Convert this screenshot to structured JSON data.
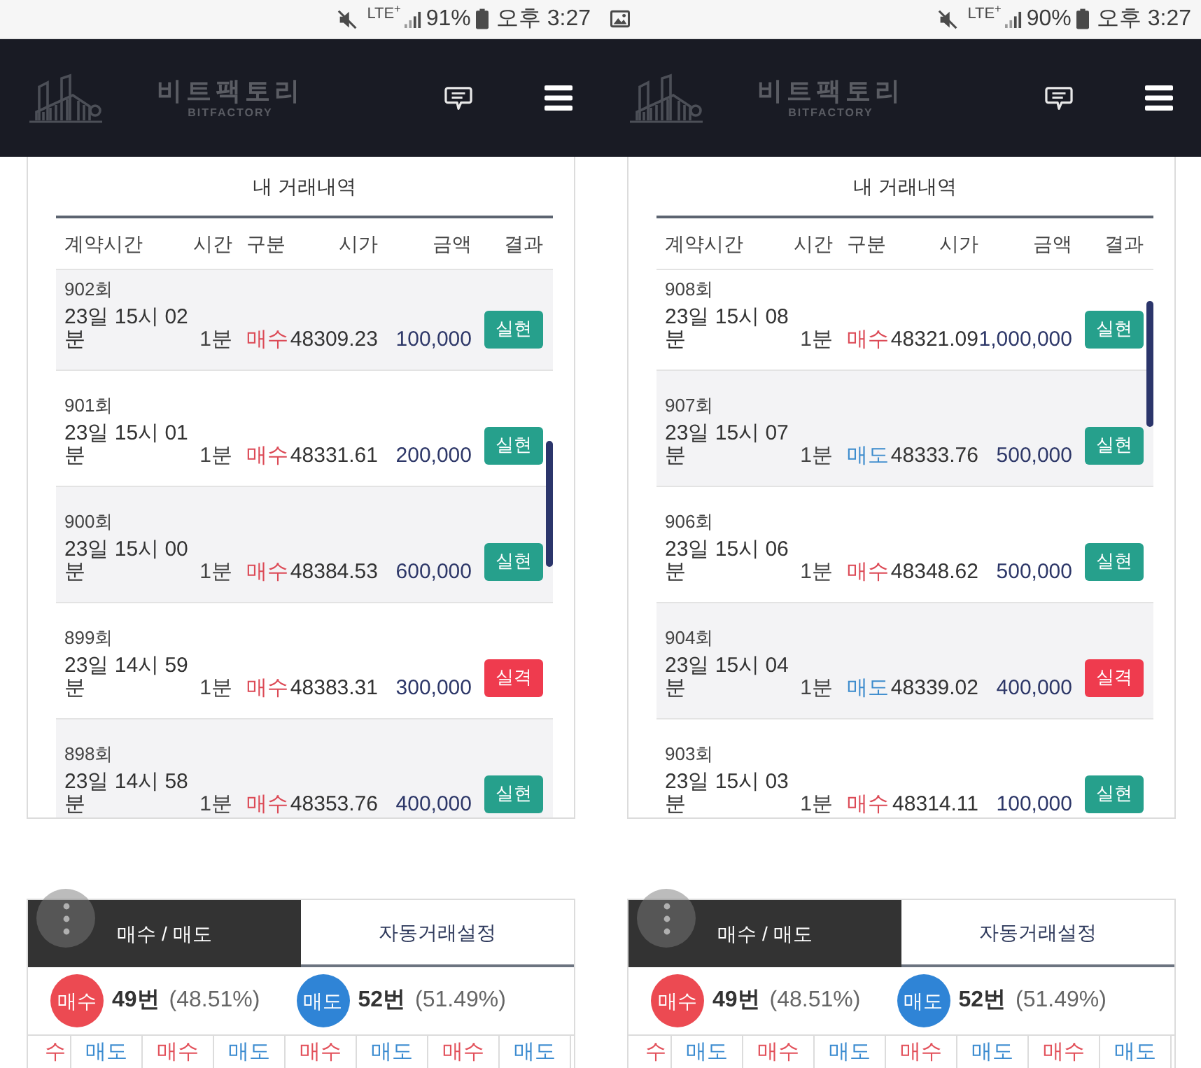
{
  "screens": [
    {
      "status_bar": {
        "image_notification": false,
        "network": "LTE$^{+}$",
        "battery": "91%",
        "clock": "오후 3:27"
      },
      "header": {
        "brand": "비트팩토리",
        "brand_sub": "BITFACTORY"
      },
      "history": {
        "title": "내 거래내역",
        "columns": [
          "계약시간",
          "시간",
          "구분",
          "시가",
          "금액",
          "결과"
        ],
        "rows": [
          {
            "round": "902회",
            "date": "23일 15시 02분",
            "duration": "1분",
            "side": {
              "text": "매수",
              "color": "#dc4a56"
            },
            "price": "48309.23",
            "amount": "100,000",
            "result": {
              "text": "실현",
              "color": "#26a08c"
            },
            "shaded": true
          },
          {
            "round": "901회",
            "date": "23일 15시 01분",
            "duration": "1분",
            "side": {
              "text": "매수",
              "color": "#dc4a56"
            },
            "price": "48331.61",
            "amount": "200,000",
            "result": {
              "text": "실현",
              "color": "#26a08c"
            },
            "shaded": false
          },
          {
            "round": "900회",
            "date": "23일 15시 00분",
            "duration": "1분",
            "side": {
              "text": "매수",
              "color": "#dc4a56"
            },
            "price": "48384.53",
            "amount": "600,000",
            "result": {
              "text": "실현",
              "color": "#26a08c"
            },
            "shaded": true
          },
          {
            "round": "899회",
            "date": "23일 14시 59분",
            "duration": "1분",
            "side": {
              "text": "매수",
              "color": "#dc4a56"
            },
            "price": "48383.31",
            "amount": "300,000",
            "result": {
              "text": "실격",
              "color": "#ef3b4e"
            },
            "shaded": false
          },
          {
            "round": "898회",
            "date": "23일 14시 58분",
            "duration": "1분",
            "side": {
              "text": "매수",
              "color": "#dc4a56"
            },
            "price": "48353.76",
            "amount": "400,000",
            "result": {
              "text": "실현",
              "color": "#26a08c"
            },
            "shaded": true
          }
        ]
      },
      "tabs": [
        {
          "label": "매수 / 매도",
          "selected": true
        },
        {
          "label": "자동거래설정",
          "selected": false
        }
      ],
      "stats": [
        {
          "badge": "매수",
          "color": "#ec4a52",
          "count": "49번",
          "percent": "(48.51%)"
        },
        {
          "badge": "매도",
          "color": "#2f84d6",
          "count": "52번",
          "percent": "(51.49%)"
        }
      ],
      "strip": [
        {
          "text": "수",
          "color": "#e2505a"
        },
        {
          "text": "매도",
          "color": "#3b8bd0"
        },
        {
          "text": "매수",
          "color": "#e2505a"
        },
        {
          "text": "매도",
          "color": "#3b8bd0"
        },
        {
          "text": "매수",
          "color": "#e2505a"
        },
        {
          "text": "매도",
          "color": "#3b8bd0"
        },
        {
          "text": "매수",
          "color": "#e2505a"
        },
        {
          "text": "매도",
          "color": "#3b8bd0"
        }
      ]
    },
    {
      "status_bar": {
        "image_notification": true,
        "network": "LTE$^{+}$",
        "battery": "90%",
        "clock": "오후 3:27"
      },
      "header": {
        "brand": "비트팩토리",
        "brand_sub": "BITFACTORY"
      },
      "history": {
        "title": "내 거래내역",
        "columns": [
          "계약시간",
          "시간",
          "구분",
          "시가",
          "금액",
          "결과"
        ],
        "rows": [
          {
            "round": "908회",
            "date": "23일 15시 08분",
            "duration": "1분",
            "side": {
              "text": "매수",
              "color": "#dc4a56"
            },
            "price": "48321.09",
            "amount": "1,000,000",
            "result": {
              "text": "실현",
              "color": "#26a08c"
            },
            "shaded": false
          },
          {
            "round": "907회",
            "date": "23일 15시 07분",
            "duration": "1분",
            "side": {
              "text": "매도",
              "color": "#3d8ccd"
            },
            "price": "48333.76",
            "amount": "500,000",
            "result": {
              "text": "실현",
              "color": "#26a08c"
            },
            "shaded": true
          },
          {
            "round": "906회",
            "date": "23일 15시 06분",
            "duration": "1분",
            "side": {
              "text": "매수",
              "color": "#dc4a56"
            },
            "price": "48348.62",
            "amount": "500,000",
            "result": {
              "text": "실현",
              "color": "#26a08c"
            },
            "shaded": false
          },
          {
            "round": "904회",
            "date": "23일 15시 04분",
            "duration": "1분",
            "side": {
              "text": "매도",
              "color": "#3d8ccd"
            },
            "price": "48339.02",
            "amount": "400,000",
            "result": {
              "text": "실격",
              "color": "#ef3b4e"
            },
            "shaded": true
          },
          {
            "round": "903회",
            "date": "23일 15시 03분",
            "duration": "1분",
            "side": {
              "text": "매수",
              "color": "#dc4a56"
            },
            "price": "48314.11",
            "amount": "100,000",
            "result": {
              "text": "실현",
              "color": "#26a08c"
            },
            "shaded": false
          }
        ]
      },
      "tabs": [
        {
          "label": "매수 / 매도",
          "selected": true
        },
        {
          "label": "자동거래설정",
          "selected": false
        }
      ],
      "stats": [
        {
          "badge": "매수",
          "color": "#ec4a52",
          "count": "49번",
          "percent": "(48.51%)"
        },
        {
          "badge": "매도",
          "color": "#2f84d6",
          "count": "52번",
          "percent": "(51.49%)"
        }
      ],
      "strip": [
        {
          "text": "수",
          "color": "#e2505a"
        },
        {
          "text": "매도",
          "color": "#3b8bd0"
        },
        {
          "text": "매수",
          "color": "#e2505a"
        },
        {
          "text": "매도",
          "color": "#3b8bd0"
        },
        {
          "text": "매수",
          "color": "#e2505a"
        },
        {
          "text": "매도",
          "color": "#3b8bd0"
        },
        {
          "text": "매수",
          "color": "#e2505a"
        },
        {
          "text": "매도",
          "color": "#3b8bd0"
        }
      ]
    }
  ]
}
